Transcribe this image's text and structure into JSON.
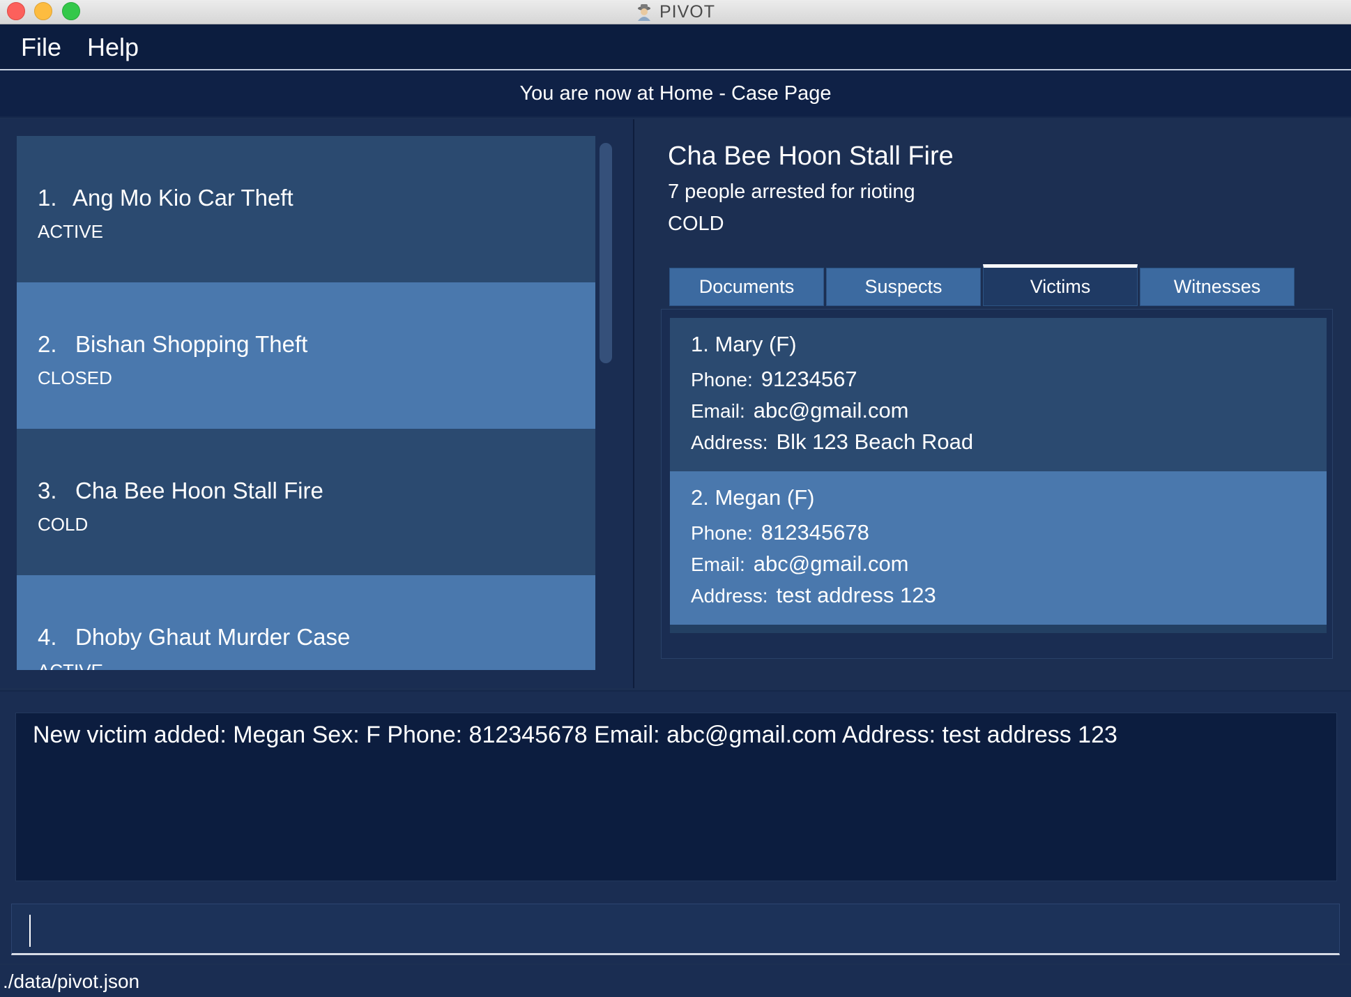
{
  "window": {
    "title": "PIVOT",
    "app_icon": "detective-icon"
  },
  "menu": {
    "file": "File",
    "help": "Help"
  },
  "result_bar": "You are now at Home - Case Page",
  "cases": [
    {
      "index": "1.",
      "title": "Ang Mo Kio Car Theft",
      "status": "ACTIVE"
    },
    {
      "index": "2.",
      "title": "Bishan Shopping Theft",
      "status": "CLOSED"
    },
    {
      "index": "3.",
      "title": "Cha Bee Hoon Stall Fire",
      "status": "COLD"
    },
    {
      "index": "4.",
      "title": "Dhoby Ghaut Murder Case",
      "status": "ACTIVE"
    }
  ],
  "selected_case": {
    "title": "Cha Bee Hoon Stall Fire",
    "description": "7 people arrested for rioting",
    "status": "COLD"
  },
  "tabs": [
    "Documents",
    "Suspects",
    "Victims",
    "Witnesses"
  ],
  "active_tab": "Victims",
  "victims": [
    {
      "heading": "1.  Mary  (F)",
      "phone_label": "Phone:",
      "phone": "91234567",
      "email_label": "Email:",
      "email": "abc@gmail.com",
      "address_label": "Address:",
      "address": "Blk 123 Beach Road"
    },
    {
      "heading": "2.  Megan  (F)",
      "phone_label": "Phone:",
      "phone": "812345678",
      "email_label": "Email:",
      "email": "abc@gmail.com",
      "address_label": "Address:",
      "address": "test address 123"
    }
  ],
  "console": "New victim added: Megan Sex: F Phone: 812345678 Email: abc@gmail.com Address: test address 123",
  "command_input": {
    "value": ""
  },
  "status_bar": "./data/pivot.json",
  "colors": {
    "background": "#1c2f52",
    "card_dark": "#2b4a70",
    "card_light": "#4a78ad",
    "menubar": "#0c1d3f"
  }
}
